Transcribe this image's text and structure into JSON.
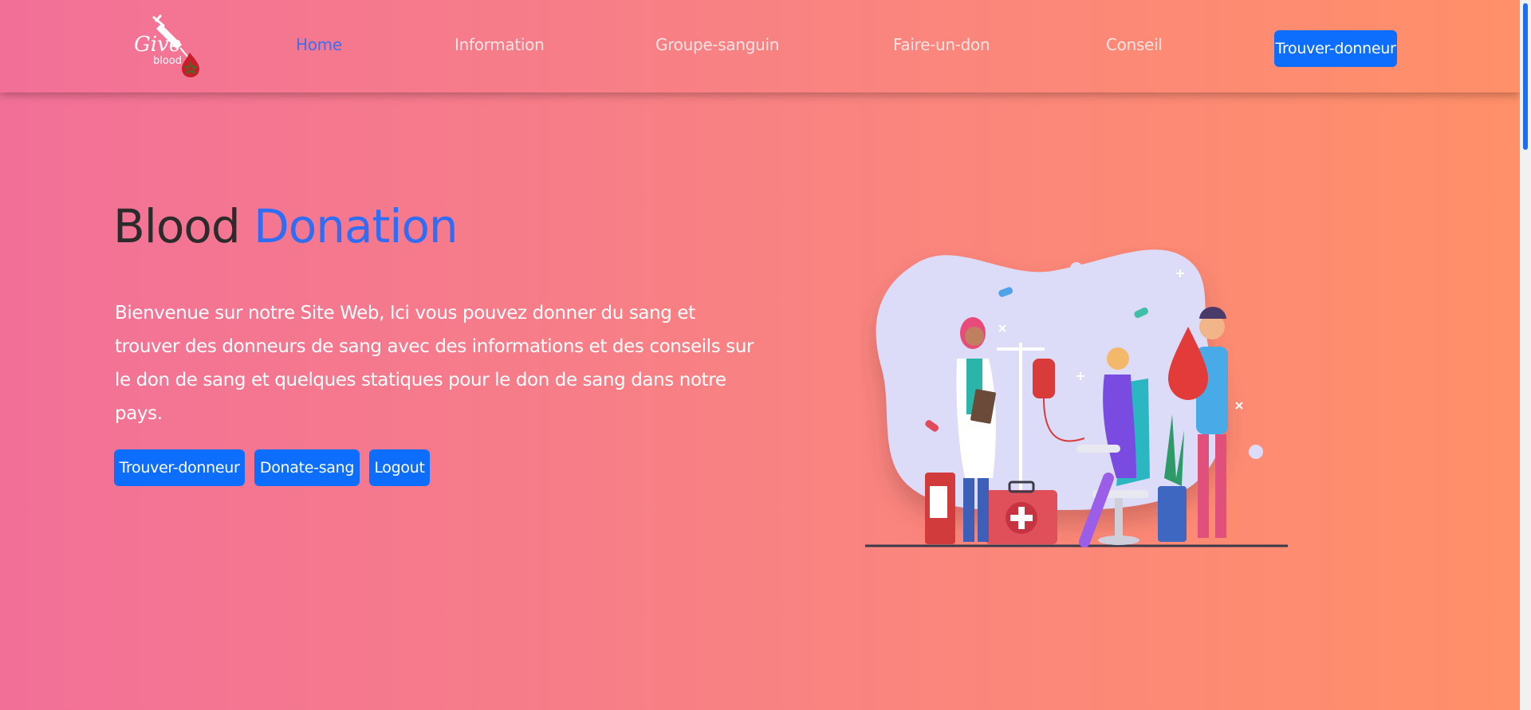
{
  "nav": {
    "logo": {
      "text_main": "Give",
      "text_sub": "blood"
    },
    "links": [
      {
        "label": "Home",
        "active": true
      },
      {
        "label": "Information",
        "active": false
      },
      {
        "label": "Groupe-sanguin",
        "active": false
      },
      {
        "label": "Faire-un-don",
        "active": false
      },
      {
        "label": "Conseil",
        "active": false
      }
    ],
    "cta_label": "Trouver-donneur"
  },
  "hero": {
    "title_part1": "Blood",
    "title_part2": "Donation",
    "description": "Bienvenue sur notre Site Web, Ici vous pouvez donner du sang et trouver des donneurs de sang avec des informations et des conseils sur le don de sang et quelques statiques pour le don de sang dans notre pays.",
    "buttons": [
      {
        "label": "Trouver-donneur"
      },
      {
        "label": "Donate-sang"
      },
      {
        "label": "Logout"
      }
    ]
  },
  "colors": {
    "gradient_start": "#f27098",
    "gradient_end": "#ff9068",
    "primary_button": "#0d6efd",
    "accent_text": "#2f6df5",
    "nav_active": "#3f6ef0"
  },
  "icons": {
    "logo": "syringe-blood-drop-icon",
    "illustration": "blood-donation-illustration"
  }
}
